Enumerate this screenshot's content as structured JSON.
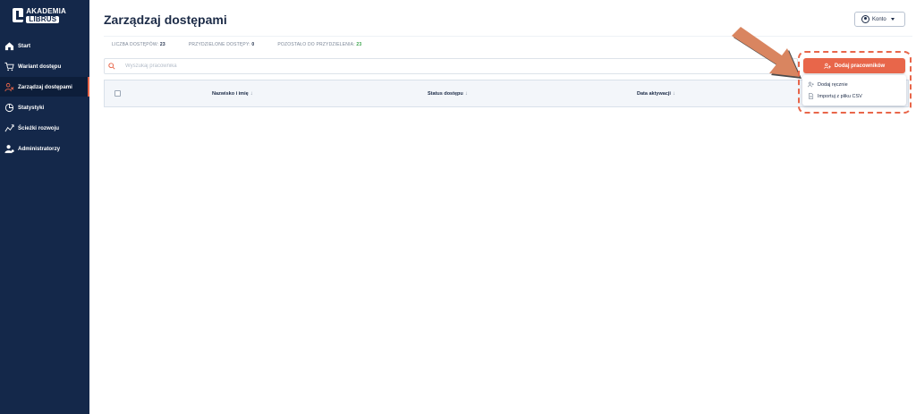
{
  "app": {
    "logo_line1": "AKADEMIA",
    "logo_line2": "LIBRUS"
  },
  "sidebar": {
    "items": [
      {
        "label": "Start",
        "icon": "home-icon",
        "active": false
      },
      {
        "label": "Wariant dostępu",
        "icon": "cart-icon",
        "active": false
      },
      {
        "label": "Zarządzaj dostępami",
        "icon": "users-icon",
        "active": true
      },
      {
        "label": "Statystyki",
        "icon": "chart-icon",
        "active": false
      },
      {
        "label": "Ścieżki rozwoju",
        "icon": "path-icon",
        "active": false
      },
      {
        "label": "Administratorzy",
        "icon": "admin-icon",
        "active": false
      }
    ]
  },
  "header": {
    "title": "Zarządzaj dostępami",
    "account_label": "Konto"
  },
  "stats": {
    "total_label": "LICZBA DOSTĘPÓW:",
    "total_value": "23",
    "assigned_label": "PRZYDZIELONE DOSTĘPY:",
    "assigned_value": "0",
    "remaining_label": "POZOSTAŁO DO PRZYDZIELENIA:",
    "remaining_value": "23"
  },
  "search": {
    "placeholder": "Wyszukaj pracownika"
  },
  "table": {
    "columns": [
      "Nazwisko i imię",
      "Status dostępu",
      "Data aktywacji"
    ]
  },
  "actions": {
    "add_button_label": "Dodaj pracowników",
    "menu": [
      {
        "label": "Dodaj ręcznie",
        "icon": "add-user-icon"
      },
      {
        "label": "Importuj z pliku CSV",
        "icon": "file-icon"
      }
    ]
  },
  "colors": {
    "sidebar_bg": "#14284a",
    "accent": "#e8664a",
    "success": "#3aa34a"
  }
}
